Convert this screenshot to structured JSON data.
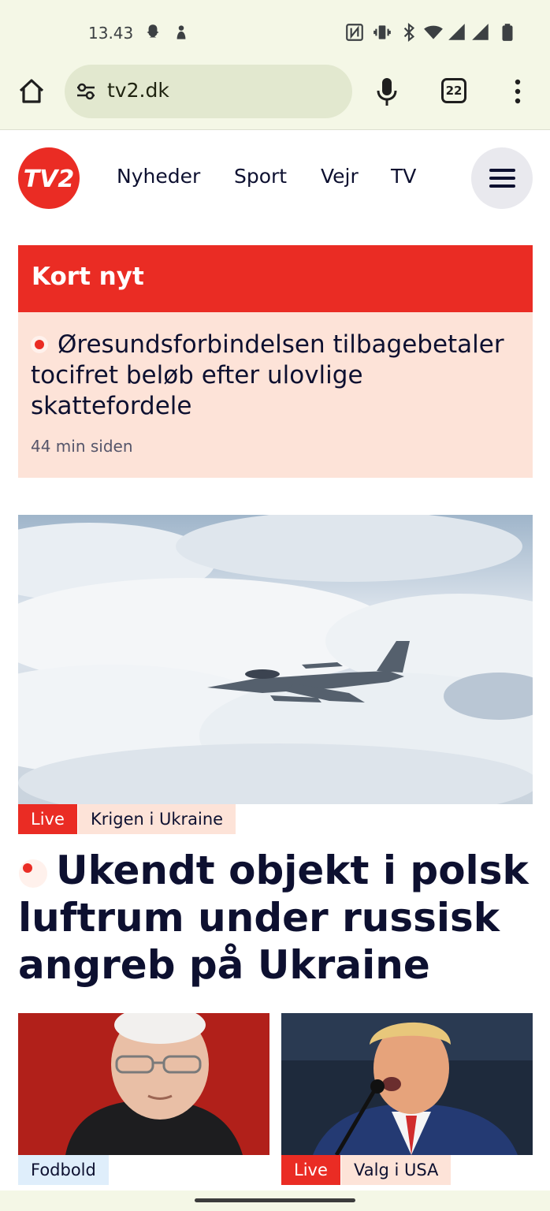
{
  "status_bar": {
    "time": "13.43",
    "left_icons": [
      "snapchat-icon",
      "snapchat-icon"
    ],
    "right_icons": [
      "nfc-icon",
      "vibrate-icon",
      "bluetooth-icon",
      "wifi-icon",
      "signal-icon",
      "signal-icon",
      "battery-icon"
    ]
  },
  "browser": {
    "url": "tv2.dk",
    "tab_count": "22"
  },
  "site": {
    "logo_text": "TV2",
    "nav": [
      "Nyheder",
      "Sport",
      "Vejr",
      "TV"
    ]
  },
  "kort_nyt": {
    "title": "Kort nyt",
    "headline": "Øresundsforbindelsen tilbagebetaler tocifret beløb efter ulovlige skattefordele",
    "time": "44 min siden"
  },
  "hero": {
    "tag_live": "Live",
    "tag_category": "Krigen i Ukraine",
    "headline": "Ukendt objekt i polsk luftrum under russisk angreb på Ukraine"
  },
  "cards": [
    {
      "tag": "Fodbold"
    },
    {
      "tag_live": "Live",
      "tag": "Valg i USA"
    }
  ],
  "colors": {
    "brand_red": "#ea2c24",
    "light_pink": "#fde3d8",
    "chrome_bg": "#f4f7e6",
    "text_navy": "#0d1030"
  }
}
